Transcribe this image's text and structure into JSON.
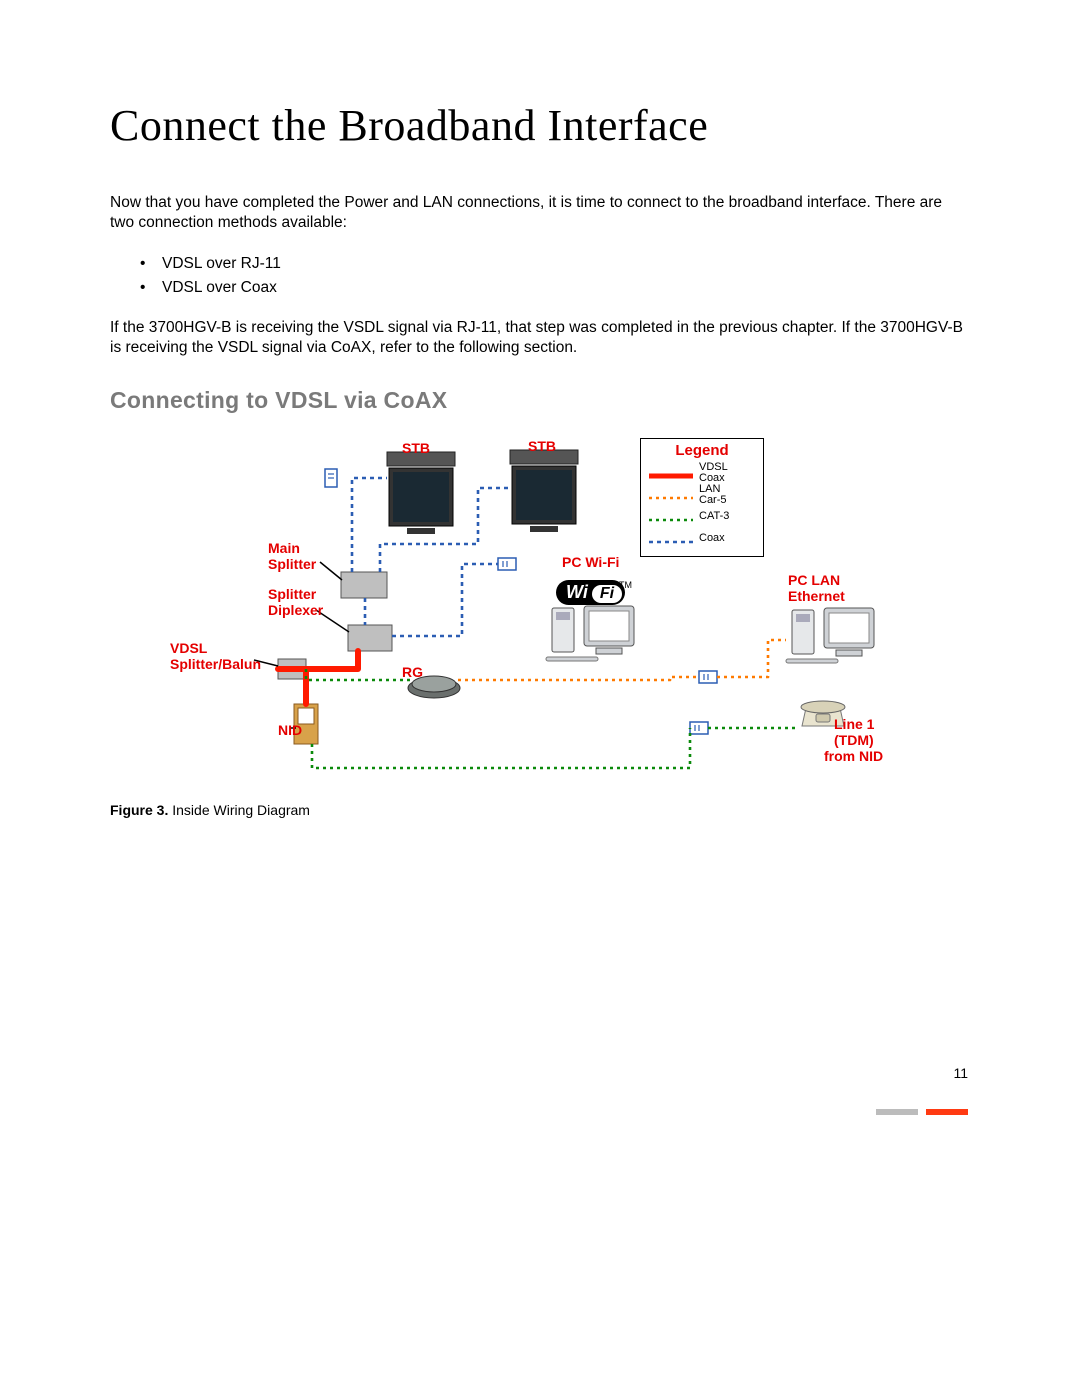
{
  "title": "Connect the Broadband Interface",
  "intro": "Now that you have completed the Power and LAN connections, it is time to connect to the broadband interface. There are two connection methods available:",
  "bullets": [
    "VDSL over RJ-11",
    "VDSL over Coax"
  ],
  "para2": "If the 3700HGV-B is receiving the VSDL signal via RJ-11, that step was completed in the previous chapter. If the 3700HGV-B is receiving the VSDL signal via CoAX, refer to the following section.",
  "h2": "Connecting to VDSL via CoAX",
  "labels": {
    "stb1": "STB",
    "stb2": "STB",
    "main_splitter_l1": "Main",
    "main_splitter_l2": "Splitter",
    "splitter_l1": "Splitter",
    "splitter_l2": "Diplexer",
    "vdsl_l1": "VDSL",
    "vdsl_l2": "Splitter/Balun",
    "nid": "NID",
    "rg": "RG",
    "pcwifi": "PC Wi-Fi",
    "pclan_l1": "PC LAN",
    "pclan_l2": "Ethernet",
    "line1_l1": "Line 1",
    "line1_l2": "(TDM)",
    "line1_l3": "from NID"
  },
  "wifi": {
    "a": "Wi",
    "b": "Fi",
    "tm": "TM"
  },
  "legend": {
    "title": "Legend",
    "rows": [
      {
        "label_l1": "VDSL",
        "label_l2": "Coax"
      },
      {
        "label_l1": "LAN",
        "label_l2": "Car-5"
      },
      {
        "label_l1": "CAT-3",
        "label_l2": ""
      },
      {
        "label_l1": "Coax",
        "label_l2": ""
      }
    ]
  },
  "caption_b": "Figure 3.",
  "caption_t": " Inside Wiring Diagram",
  "pagenum": "11"
}
